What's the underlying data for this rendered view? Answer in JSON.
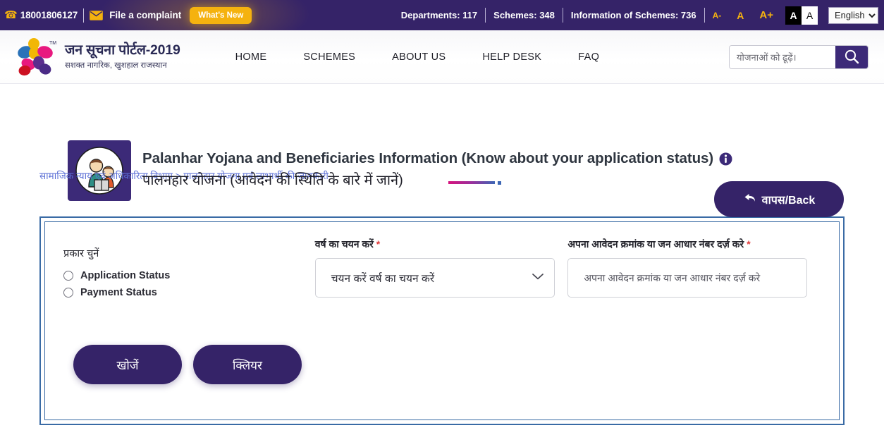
{
  "topbar": {
    "phone_icon": "phone-icon",
    "phone": "18001806127",
    "mail_icon": "mail-icon",
    "complaint_label": "File a complaint",
    "whats_new_label": "What's New",
    "stats": [
      "Departments: 117",
      "Schemes: 348",
      "Information of Schemes: 736"
    ],
    "font_smaller": "A-",
    "font_normal": "A",
    "font_larger": "A+",
    "contrast_dark": "A",
    "contrast_light": "A",
    "language_selected": "English",
    "language_options": [
      "English"
    ]
  },
  "header": {
    "logo_icon": "jan-soochna-logo",
    "brand_title": "जन सूचना पोर्टल-2019",
    "brand_subtitle": "सशक्त  नागरिक,  खुशहाल  राजस्थान",
    "nav": [
      {
        "label": "HOME"
      },
      {
        "label": "SCHEMES"
      },
      {
        "label": "ABOUT US"
      },
      {
        "label": "HELP DESK"
      },
      {
        "label": "FAQ"
      }
    ],
    "search_placeholder": "योजनाओं को ढूढ़ें।",
    "search_value": "",
    "search_icon": "search-icon"
  },
  "page": {
    "breadcrumb": "सामाजिक न्याय एवं अधिकारिता विभाग > पालनहार योजना एवं लाभार्थी की जानकारी",
    "back_label": "वापस/Back",
    "back_icon": "back-arrow-icon",
    "scheme_icon": "palanhar-family-icon",
    "title_en": "Palanhar Yojana and Beneficiaries Information (Know about your application status)",
    "title_info_icon": "info-icon",
    "title_hi": "पालनहार योजना (आवेदन की स्थिति के बारे में जानें)"
  },
  "form": {
    "type_label": "प्रकार चुनें",
    "radios": [
      {
        "label": "Application Status",
        "checked": false
      },
      {
        "label": "Payment Status",
        "checked": false
      }
    ],
    "year_label": "वर्ष का चयन करें",
    "year_required": "*",
    "year_selected": "चयन करें वर्ष का चयन करें",
    "year_caret_icon": "chevron-down-icon",
    "id_label": "अपना आवेदन क्रमांक या जन आधार नंबर दर्ज़ करे",
    "id_required": "*",
    "id_placeholder": "अपना आवेदन क्रमांक या जन आधार नंबर दर्ज़ करे",
    "id_value": "",
    "search_button": "खोजें",
    "clear_button": "क्लियर"
  },
  "colors": {
    "topbar_purple": "#352368",
    "accent_gold": "#f5b20f",
    "panel_border_blue": "#3a6ba5",
    "breadcrumb_blue": "#5b6fd6",
    "required_red": "#e03b3b"
  }
}
